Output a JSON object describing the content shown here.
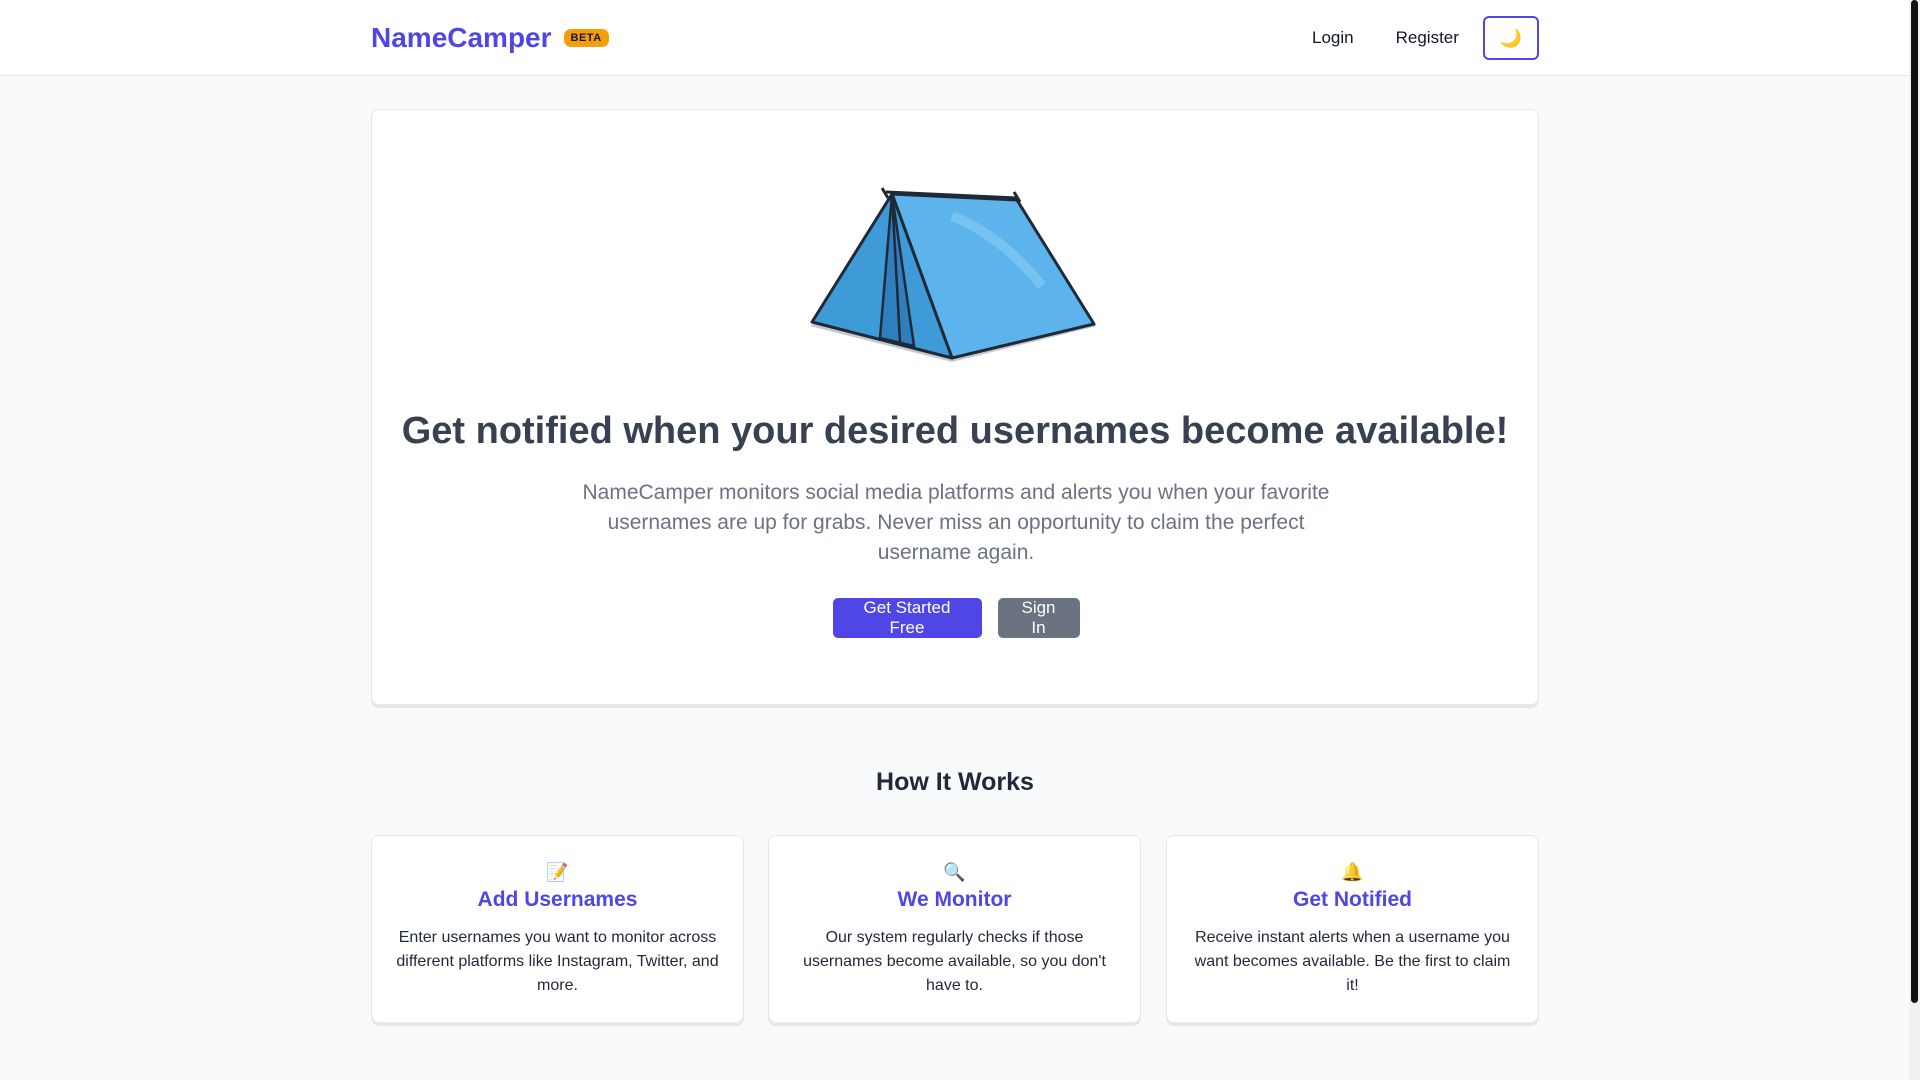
{
  "navbar": {
    "brand": "NameCamper",
    "badge": "BETA",
    "login": "Login",
    "register": "Register",
    "theme_toggle_icon": "🌙"
  },
  "hero": {
    "title": "Get notified when your desired usernames become available!",
    "description": "NameCamper monitors social media platforms and alerts you when your favorite usernames are up for grabs. Never miss an opportunity to claim the perfect username again.",
    "primary_button": "Get Started Free",
    "secondary_button": "Sign In"
  },
  "how_it_works": {
    "title": "How It Works",
    "features": [
      {
        "icon": "📝",
        "title": "Add Usernames",
        "description": "Enter usernames you want to monitor across different platforms like Instagram, Twitter, and more."
      },
      {
        "icon": "🔍",
        "title": "We Monitor",
        "description": "Our system regularly checks if those usernames become available, so you don't have to."
      },
      {
        "icon": "🔔",
        "title": "Get Notified",
        "description": "Receive instant alerts when a username you want becomes available. Be the first to claim it!"
      }
    ]
  },
  "colors": {
    "accent": "#4f46e5",
    "badge": "#f59e0b",
    "secondary": "#6b7280",
    "tent": "#4aa8e6"
  }
}
